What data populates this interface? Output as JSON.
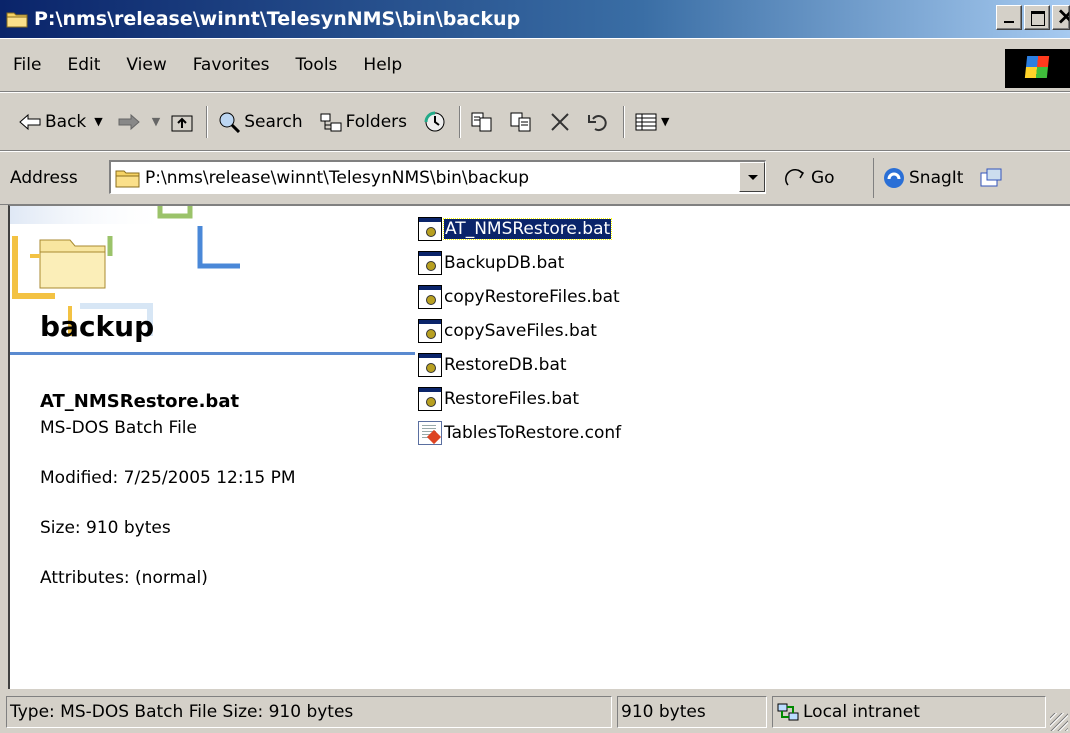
{
  "window": {
    "title": "P:\\nms\\release\\winnt\\TelesynNMS\\bin\\backup"
  },
  "menu": [
    "File",
    "Edit",
    "View",
    "Favorites",
    "Tools",
    "Help"
  ],
  "toolbar": {
    "back": "Back",
    "search": "Search",
    "folders": "Folders"
  },
  "address": {
    "label": "Address",
    "path": "P:\\nms\\release\\winnt\\TelesynNMS\\bin\\backup",
    "go": "Go",
    "snagit": "SnagIt"
  },
  "left_pane": {
    "folder_name": "backup",
    "selected_name": "AT_NMSRestore.bat",
    "selected_type": "MS-DOS Batch File",
    "modified": "Modified: 7/25/2005 12:15 PM",
    "size": "Size: 910 bytes",
    "attributes": "Attributes: (normal)"
  },
  "files": [
    {
      "name": "AT_NMSRestore.bat",
      "icon": "batch-file-icon",
      "selected": true
    },
    {
      "name": "BackupDB.bat",
      "icon": "batch-file-icon"
    },
    {
      "name": "copyRestoreFiles.bat",
      "icon": "batch-file-icon"
    },
    {
      "name": "copySaveFiles.bat",
      "icon": "batch-file-icon"
    },
    {
      "name": "RestoreDB.bat",
      "icon": "batch-file-icon"
    },
    {
      "name": "RestoreFiles.bat",
      "icon": "batch-file-icon"
    },
    {
      "name": "TablesToRestore.conf",
      "icon": "config-file-icon"
    }
  ],
  "status": {
    "info": "Type: MS-DOS Batch File Size: 910 bytes",
    "size": "910 bytes",
    "zone": "Local intranet"
  }
}
